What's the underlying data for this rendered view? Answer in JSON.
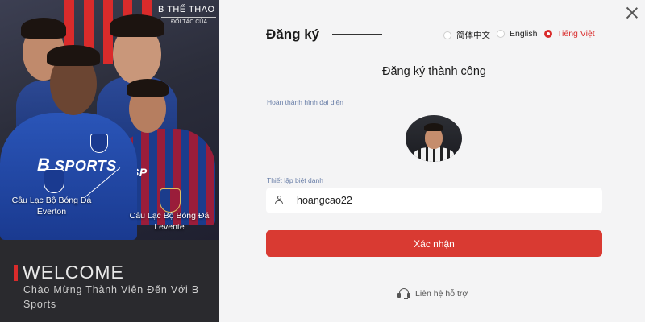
{
  "promo": {
    "brand_title": "B THỂ THAO",
    "brand_partner": "ĐỐI TÁC CỦA",
    "sponsor_text": "SPORTS",
    "sponsor_text_2": "SP",
    "club_left": "Câu Lạc Bộ Bóng Đá Everton",
    "club_right": "Câu Lạc Bộ Bóng Đá Levente",
    "welcome_title": "WELCOME",
    "welcome_subtitle": "Chào Mừng Thành Viên Đến Với B  Sports"
  },
  "form": {
    "title": "Đăng ký",
    "languages": [
      {
        "label": "简体中文",
        "selected": false
      },
      {
        "label": "English",
        "selected": false
      },
      {
        "label": "Tiếng Việt",
        "selected": true
      }
    ],
    "success_message": "Đăng ký thành công",
    "avatar_label": "Hoàn thành hình đại diện",
    "nickname_label": "Thiết lập biệt danh",
    "nickname_value": "hoangcao22",
    "submit_label": "Xác nhận",
    "support_label": "Liên hệ hỗ trợ"
  },
  "colors": {
    "accent": "#d93a32",
    "promo_bg": "#2a2a2e",
    "form_bg": "#f4f4f5"
  }
}
